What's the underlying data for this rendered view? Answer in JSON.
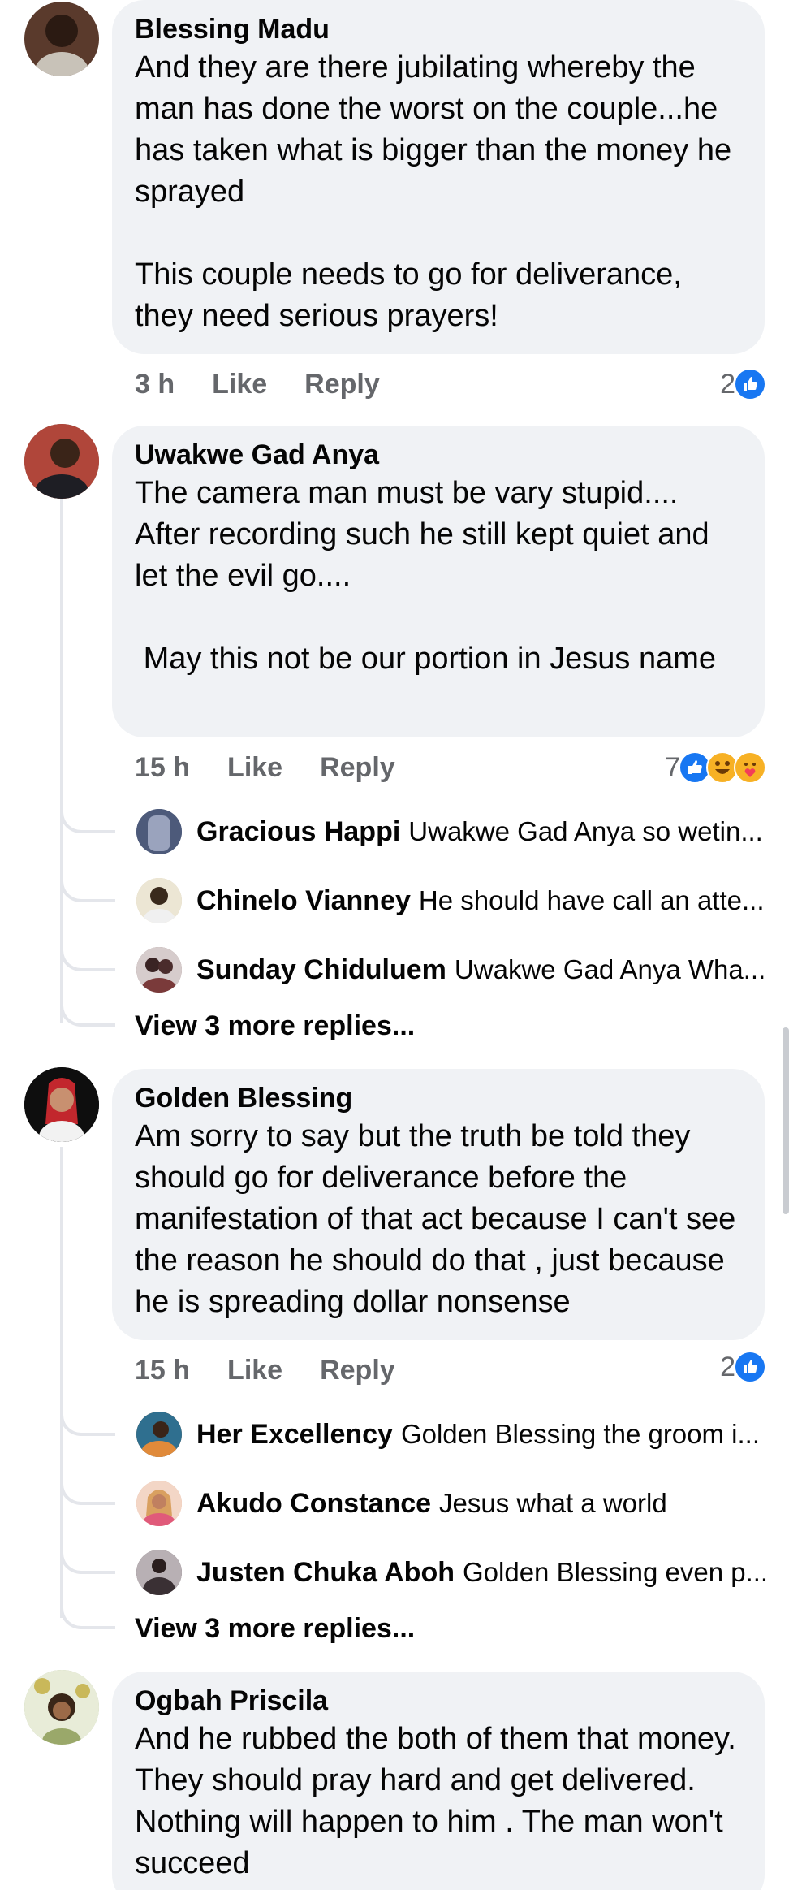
{
  "comments": [
    {
      "author": "Blessing Madu",
      "text": "And they are there jubilating whereby the man has done the worst on the couple...he has taken what is bigger than the money he sprayed\n\nThis couple needs to go for deliverance, they need serious prayers!",
      "time": "3 h",
      "like_label": "Like",
      "reply_label": "Reply",
      "reaction_count": "2",
      "reactions": [
        "like-icon"
      ],
      "avatar_color": "#5a3a2c"
    },
    {
      "author": "Uwakwe Gad Anya",
      "text": "The camera man must be vary stupid.... After recording such he still kept quiet and let the evil go....\n\n May this not be our portion in Jesus name",
      "time": "15 h",
      "like_label": "Like",
      "reply_label": "Reply",
      "reaction_count": "7",
      "reactions": [
        "like-icon",
        "haha-icon",
        "care-icon"
      ],
      "avatar_color": "#7a5a48",
      "replies": [
        {
          "name": "Gracious Happi",
          "text": "Uwakwe Gad Anya so wetin...",
          "avatar_color": "#6d7a96"
        },
        {
          "name": "Chinelo Vianney",
          "text": "He should have call an atte...",
          "avatar_color": "#d8c9a8"
        },
        {
          "name": "Sunday Chiduluem",
          "text": "Uwakwe Gad Anya Wha...",
          "avatar_color": "#8c7070"
        }
      ],
      "more_replies": "View 3 more replies..."
    },
    {
      "author": "Golden Blessing",
      "text": "Am sorry to say but the truth be told they should go for deliverance before the manifestation of that act because I can't see the reason he should do that , just because he is spreading dollar nonsense",
      "time": "15 h",
      "like_label": "Like",
      "reply_label": "Reply",
      "reaction_count": "2",
      "reactions": [
        "like-icon"
      ],
      "avatar_color": "#1b1b1b",
      "replies": [
        {
          "name": "Her Excellency",
          "text": "Golden Blessing the groom i...",
          "avatar_color": "#c9783a"
        },
        {
          "name": "Akudo Constance",
          "text": "Jesus what a world",
          "avatar_color": "#e0a48a"
        },
        {
          "name": "Justen Chuka Aboh",
          "text": "Golden Blessing even p...",
          "avatar_color": "#5a4a50"
        }
      ],
      "more_replies": "View 3 more replies..."
    },
    {
      "author": "Ogbah Priscila",
      "text": "And he rubbed the both of them that money. They should pray hard and get delivered. Nothing will happen to him . The man won't succeed",
      "avatar_color": "#a8b88a"
    }
  ]
}
